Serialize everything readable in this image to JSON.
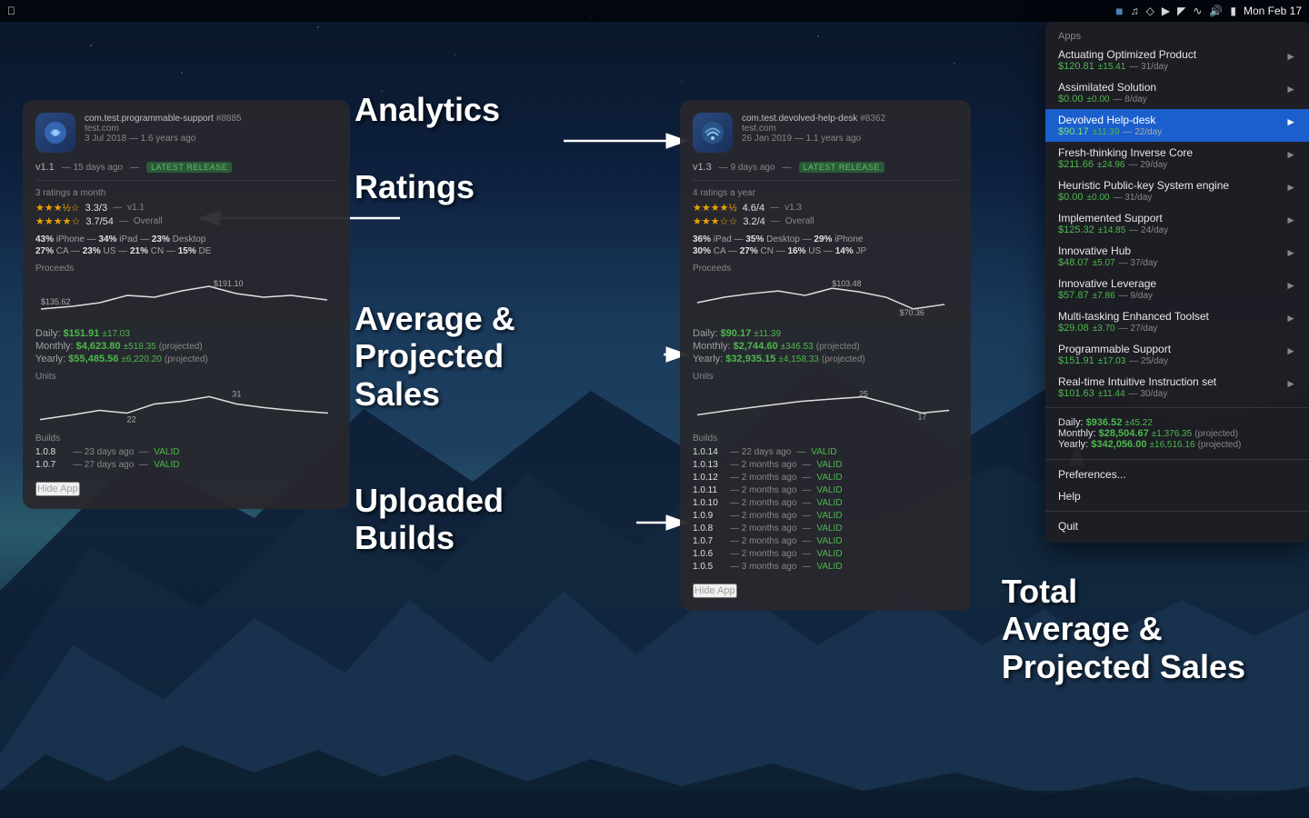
{
  "menubar": {
    "time": "Mon Feb 17",
    "icons": [
      "appicon",
      "music-note",
      "dropbox",
      "hdutil",
      "airplay",
      "wifi-bars",
      "volume",
      "battery"
    ]
  },
  "annotations": {
    "analytics": "Analytics",
    "ratings": "Ratings",
    "avg_sales": "Average &\nProjected\nSales",
    "builds": "Uploaded\nBuilds",
    "total": "Total\nAverage &\nProjected Sales"
  },
  "app1": {
    "bundle": "com.test.programmable-support",
    "badge": "#8885",
    "url": "test.com",
    "date": "3 Jul 2018",
    "years": "1.6 years ago",
    "version": "v1.1",
    "days_ago": "15 days ago",
    "latest_label": "LATEST RELEASE",
    "ratings_period": "3 ratings a month",
    "rating1_stars": "★★★½☆",
    "rating1_score": "3.3/3",
    "rating1_version": "v1.1",
    "rating2_stars": "★★★★☆",
    "rating2_score": "3.7/54",
    "rating2_label": "Overall",
    "platform1": "43% iPhone",
    "platform2": "34% iPad",
    "platform3": "23% Desktop",
    "geo1": "27% CA",
    "geo2": "23% US",
    "geo3": "21% CN",
    "geo4": "15% DE",
    "proceeds_label": "Proceeds",
    "chart_high": "$191.10",
    "chart_low": "$135.62",
    "daily_label": "Daily:",
    "daily_amount": "$151.91",
    "daily_variance": "±17.03",
    "monthly_label": "Monthly:",
    "monthly_amount": "$4,623.80",
    "monthly_variance": "±518.35",
    "monthly_projected": "(projected)",
    "yearly_label": "Yearly:",
    "yearly_amount": "$55,485.56",
    "yearly_variance": "±6,220.20",
    "yearly_projected": "(projected)",
    "units_label": "Units",
    "units_high": "31",
    "units_low": "22",
    "builds_label": "Builds",
    "build1_version": "1.0.8",
    "build1_date": "23 days ago",
    "build1_valid": "VALID",
    "build2_version": "1.0.7",
    "build2_date": "27 days ago",
    "build2_valid": "VALID",
    "hide_btn": "Hide App"
  },
  "app2": {
    "bundle": "com.test.devolved-help-desk",
    "badge": "#8362",
    "url": "test.com",
    "date": "26 Jan 2019",
    "years": "1.1 years ago",
    "version": "v1.3",
    "days_ago": "9 days ago",
    "latest_label": "LATEST RELEASE",
    "ratings_period": "4 ratings a year",
    "rating1_stars": "★★★★½",
    "rating1_score": "4.6/4",
    "rating1_version": "v1.3",
    "rating2_stars": "★★★☆☆",
    "rating2_score": "3.2/4",
    "rating2_label": "Overall",
    "platform1": "36% iPad",
    "platform2": "35% Desktop",
    "platform3": "29% iPhone",
    "geo1": "30% CA",
    "geo2": "27% CN",
    "geo3": "16% US",
    "geo4": "14% JP",
    "proceeds_label": "Proceeds",
    "chart_high": "$103.48",
    "chart_low": "$70.36",
    "daily_label": "Daily:",
    "daily_amount": "$90.17",
    "daily_variance": "±11.39",
    "monthly_label": "Monthly:",
    "monthly_amount": "$2,744.60",
    "monthly_variance": "±346.53",
    "monthly_projected": "(projected)",
    "yearly_label": "Yearly:",
    "yearly_amount": "$32,935.15",
    "yearly_variance": "±4,158.33",
    "yearly_projected": "(projected)",
    "units_label": "Units",
    "units_high": "25",
    "units_low": "17",
    "builds_label": "Builds",
    "build1_version": "1.0.14",
    "build1_date": "22 days ago",
    "build1_valid": "VALID",
    "build2_version": "1.0.13",
    "build2_date": "2 months ago",
    "build2_valid": "VALID",
    "build3_version": "1.0.12",
    "build3_date": "2 months ago",
    "build3_valid": "VALID",
    "build4_version": "1.0.11",
    "build4_date": "2 months ago",
    "build4_valid": "VALID",
    "build5_version": "1.0.10",
    "build5_date": "2 months ago",
    "build5_valid": "VALID",
    "build6_version": "1.0.9",
    "build6_date": "2 months ago",
    "build6_valid": "VALID",
    "build7_version": "1.0.8",
    "build7_date": "2 months ago",
    "build7_valid": "VALID",
    "build8_version": "1.0.7",
    "build8_date": "2 months ago",
    "build8_valid": "VALID",
    "build9_version": "1.0.6",
    "build9_date": "2 months ago",
    "build9_valid": "VALID",
    "build10_version": "1.0.5",
    "build10_date": "3 months ago",
    "build10_valid": "VALID",
    "hide_btn": "Hide App"
  },
  "dropdown": {
    "section_apps": "Apps",
    "items": [
      {
        "name": "Actuating Optimized Product",
        "price": "$120.81",
        "variance": "±15.41",
        "daily": "31/day",
        "selected": false
      },
      {
        "name": "Assimilated Solution",
        "price": "$0.00",
        "variance": "±0.00",
        "daily": "8/day",
        "selected": false
      },
      {
        "name": "Devolved Help-desk",
        "price": "$90.17",
        "variance": "±11.39",
        "daily": "22/day",
        "selected": true
      },
      {
        "name": "Fresh-thinking Inverse Core",
        "price": "$211.66",
        "variance": "±24.96",
        "daily": "29/day",
        "selected": false
      },
      {
        "name": "Heuristic Public-key System engine",
        "price": "$0.00",
        "variance": "±0.00",
        "daily": "31/day",
        "selected": false
      },
      {
        "name": "Implemented Support",
        "price": "$125.32",
        "variance": "±14.85",
        "daily": "24/day",
        "selected": false
      },
      {
        "name": "Innovative Hub",
        "price": "$48.07",
        "variance": "±5.07",
        "daily": "37/day",
        "selected": false
      },
      {
        "name": "Innovative Leverage",
        "price": "$57.87",
        "variance": "±7.86",
        "daily": "9/day",
        "selected": false
      },
      {
        "name": "Multi-tasking Enhanced Toolset",
        "price": "$29.08",
        "variance": "±3.70",
        "daily": "27/day",
        "selected": false
      },
      {
        "name": "Programmable Support",
        "price": "$151.91",
        "variance": "±17.03",
        "daily": "25/day",
        "selected": false
      },
      {
        "name": "Real-time Intuitive Instruction set",
        "price": "$101.63",
        "variance": "±11.44",
        "daily": "30/day",
        "selected": false
      }
    ],
    "total_daily_label": "Daily:",
    "total_daily_amount": "$936.52",
    "total_daily_variance": "±45.22",
    "total_monthly_label": "Monthly:",
    "total_monthly_amount": "$28,504.67",
    "total_monthly_variance": "±1,376.35",
    "total_monthly_projected": "(projected)",
    "total_yearly_label": "Yearly:",
    "total_yearly_amount": "$342,056.00",
    "total_yearly_variance": "±16,516.16",
    "total_yearly_projected": "(projected)",
    "preferences": "Preferences...",
    "help": "Help",
    "quit": "Quit"
  }
}
